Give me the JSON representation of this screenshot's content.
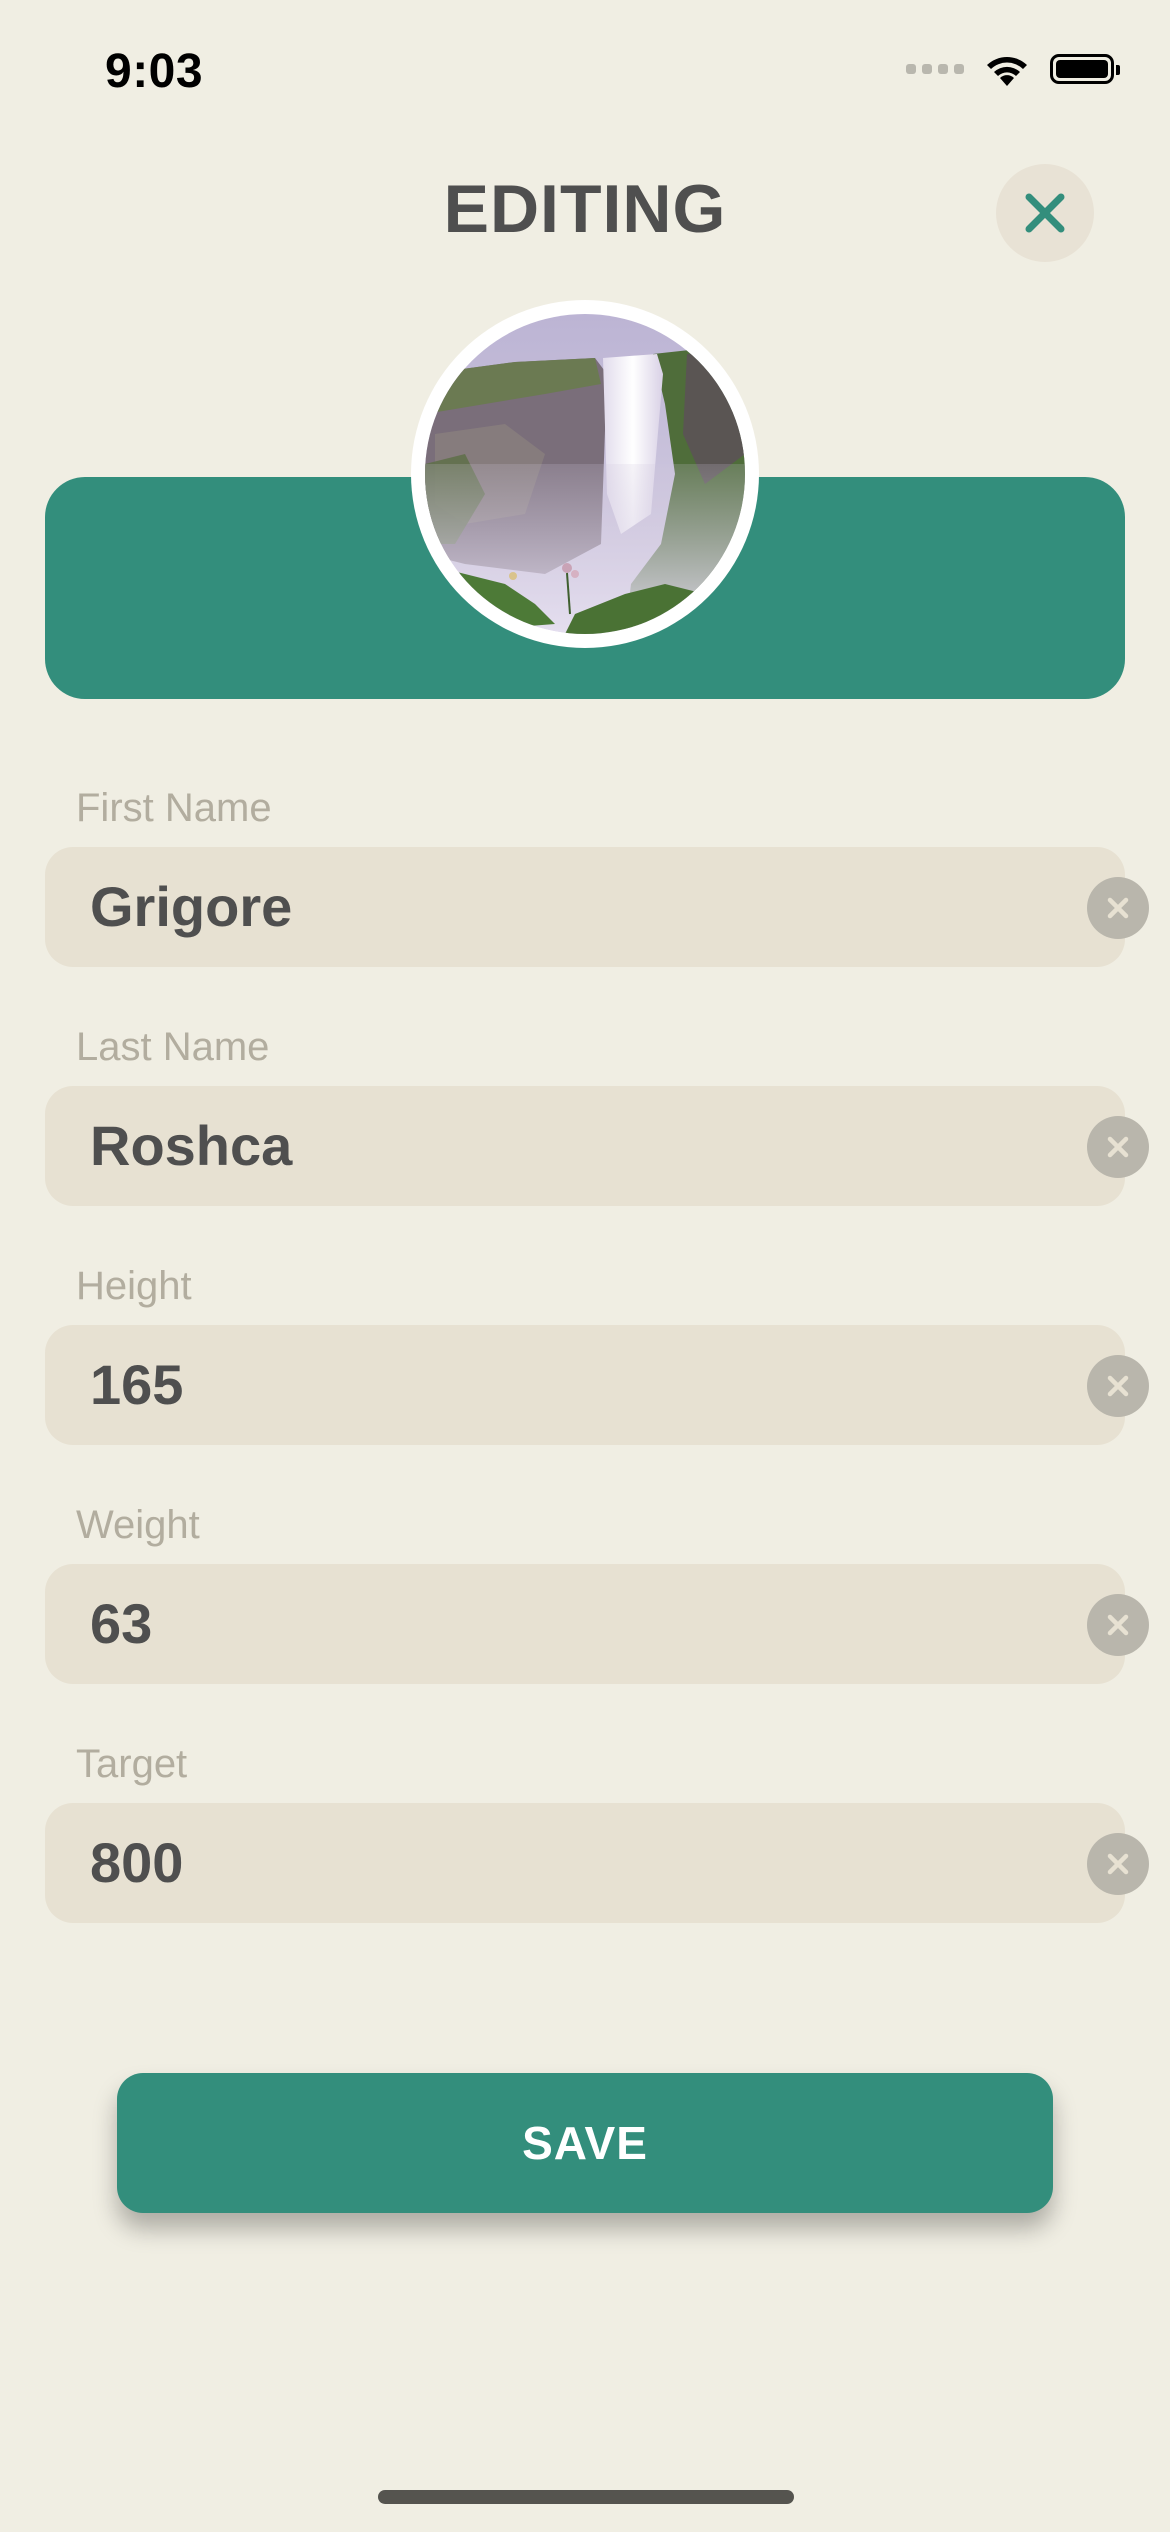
{
  "status_bar": {
    "time": "9:03",
    "icons": [
      "cellular-signal-icon",
      "wifi-icon",
      "battery-icon"
    ]
  },
  "header": {
    "title": "EDITING",
    "close_icon": "close-icon"
  },
  "profile": {
    "avatar_image": "waterfall-photo"
  },
  "fields": [
    {
      "label": "First Name",
      "value": "Grigore"
    },
    {
      "label": "Last Name",
      "value": "Roshca"
    },
    {
      "label": "Height",
      "value": "165"
    },
    {
      "label": "Weight",
      "value": "63"
    },
    {
      "label": "Target",
      "value": "800"
    }
  ],
  "actions": {
    "save_label": "SAVE"
  },
  "colors": {
    "background": "#f0eee3",
    "accent": "#338e7c",
    "field_background": "#e7e1d2",
    "label": "#b2ad9f",
    "text": "#4f4f4f"
  }
}
